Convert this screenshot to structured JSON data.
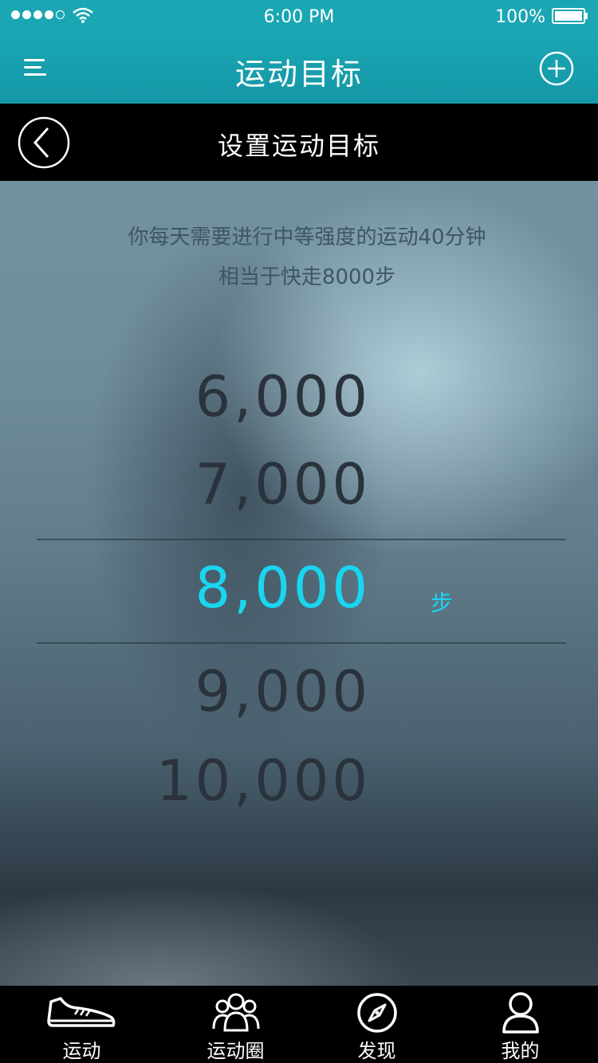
{
  "status_bar": {
    "signal_dots_filled": 4,
    "signal_dots_total": 5,
    "time": "6:00 PM",
    "battery": "100%"
  },
  "nav": {
    "title": "运动目标",
    "menu_icon": "menu-icon",
    "add_icon": "plus-circle-icon"
  },
  "subheader": {
    "title": "设置运动目标",
    "back_icon": "back-circle-icon"
  },
  "content": {
    "description_line1": "你每天需要进行中等强度的运动40分钟",
    "description_line2": "相当于快走8000步",
    "options": [
      "6,000",
      "7,000",
      "8,000",
      "9,000",
      "10,000"
    ],
    "selected": "8,000",
    "unit": "步",
    "accent_color": "#19d6f0"
  },
  "tabs": [
    {
      "label": "运动",
      "icon": "sneaker-icon"
    },
    {
      "label": "运动圈",
      "icon": "group-icon"
    },
    {
      "label": "发现",
      "icon": "compass-icon"
    },
    {
      "label": "我的",
      "icon": "person-icon"
    }
  ],
  "colors": {
    "nav_bar": "#1aa6b3",
    "tab_bar": "#000000",
    "picker_text": "#2a333b"
  }
}
